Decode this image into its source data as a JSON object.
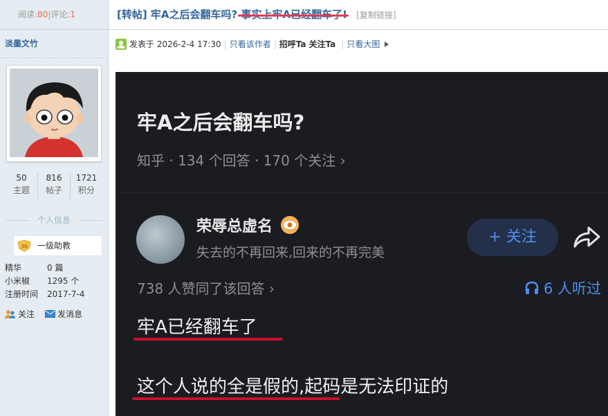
{
  "stats_top": {
    "read_label": "阅读:",
    "read_count": "80",
    "sep": "|",
    "comment_label": "评论:",
    "comment_count": "1"
  },
  "author": {
    "name": "淡墨文竹"
  },
  "user_stats": [
    {
      "value": "50",
      "label": "主题"
    },
    {
      "value": "816",
      "label": "帖子"
    },
    {
      "value": "1721",
      "label": "积分"
    }
  ],
  "personal_info_title": "个人信息",
  "rank": {
    "badge": "36",
    "title": "一级助教"
  },
  "info_rows": [
    {
      "key": "精华",
      "value": "0 篇"
    },
    {
      "key": "小米椒",
      "value": "1295 个"
    },
    {
      "key": "注册时间",
      "value": "2017-7-4"
    }
  ],
  "actions": {
    "follow": "关注",
    "message": "发消息"
  },
  "post": {
    "title_part1": "[转帖] 牢A之后会翻车吗?",
    "title_part2": "事实上牢A已经翻车了!",
    "copy_link": "[复制链接]"
  },
  "meta": {
    "posted": "发表于 2026-2-4 17:30",
    "only_author": "只看该作者",
    "greet": "招呼Ta",
    "follow": "关注Ta",
    "big_image": "只看大图"
  },
  "screenshot": {
    "question": "牢A之后会翻车吗?",
    "question_meta": "知乎 · 134 个回答 · 170 个关注 ›",
    "answer_author": "荣辱总虚名",
    "answer_sign": "失去的不再回来,回来的不再完美",
    "follow_btn": "+ 关注",
    "likes": "738 人赞同了该回答 ›",
    "listen": "6 人听过",
    "answer_line1": "牢A已经翻车了",
    "answer_line2": "这个人说的全是假的,起码是无法印证的"
  }
}
